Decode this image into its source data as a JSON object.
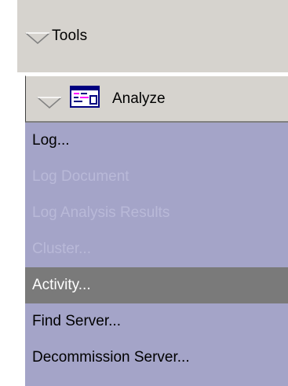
{
  "tools": {
    "label": "Tools"
  },
  "analyze": {
    "label": "Analyze",
    "items": [
      {
        "label": "Log...",
        "state": "enabled"
      },
      {
        "label": "Log Document",
        "state": "disabled"
      },
      {
        "label": "Log Analysis Results",
        "state": "disabled"
      },
      {
        "label": "Cluster...",
        "state": "disabled"
      },
      {
        "label": "Activity...",
        "state": "selected"
      },
      {
        "label": "Find Server...",
        "state": "enabled"
      },
      {
        "label": "Decommission Server...",
        "state": "enabled"
      }
    ]
  },
  "icons": {
    "tools_toggle": "chevron-down-icon",
    "analyze_toggle": "chevron-down-icon",
    "analyze_badge": "analyze-window-icon"
  },
  "colors": {
    "header_bg": "#d6d3ce",
    "menu_bg": "#a4a4c8",
    "disabled_text": "#b9b9d8",
    "selected_bg": "#7a7a7a",
    "selected_text": "#ffffff"
  }
}
